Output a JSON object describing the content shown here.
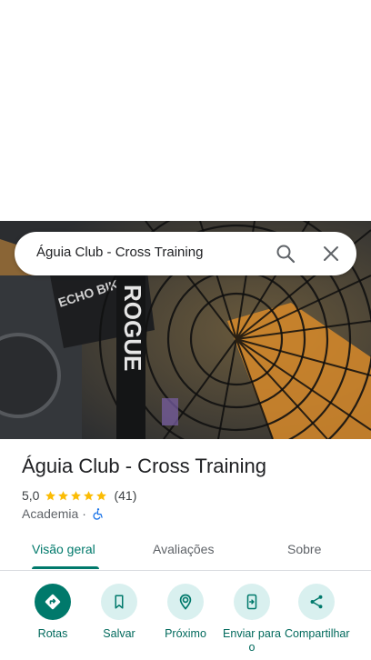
{
  "search": {
    "query": "Águia Club - Cross Training"
  },
  "place": {
    "name": "Águia Club - Cross Training",
    "rating": "5,0",
    "stars": 5,
    "review_count": "(41)",
    "category": "Academia",
    "separator": "·"
  },
  "tabs": [
    {
      "label": "Visão geral",
      "active": true
    },
    {
      "label": "Avaliações",
      "active": false
    },
    {
      "label": "Sobre",
      "active": false
    }
  ],
  "actions": [
    {
      "label": "Rotas",
      "icon": "directions-icon"
    },
    {
      "label": "Salvar",
      "icon": "bookmark-icon"
    },
    {
      "label": "Próximo",
      "icon": "nearby-icon"
    },
    {
      "label": "Enviar para o",
      "icon": "send-to-phone-icon"
    },
    {
      "label": "Compartilhar",
      "icon": "share-icon"
    }
  ],
  "photo": {
    "brand_text": "ROGUE",
    "machine_text": "ECHO BIKE"
  },
  "colors": {
    "accent": "#00796b",
    "star": "#fbbc04",
    "chip_bg": "#d9f0ef",
    "access": "#1a73e8"
  }
}
